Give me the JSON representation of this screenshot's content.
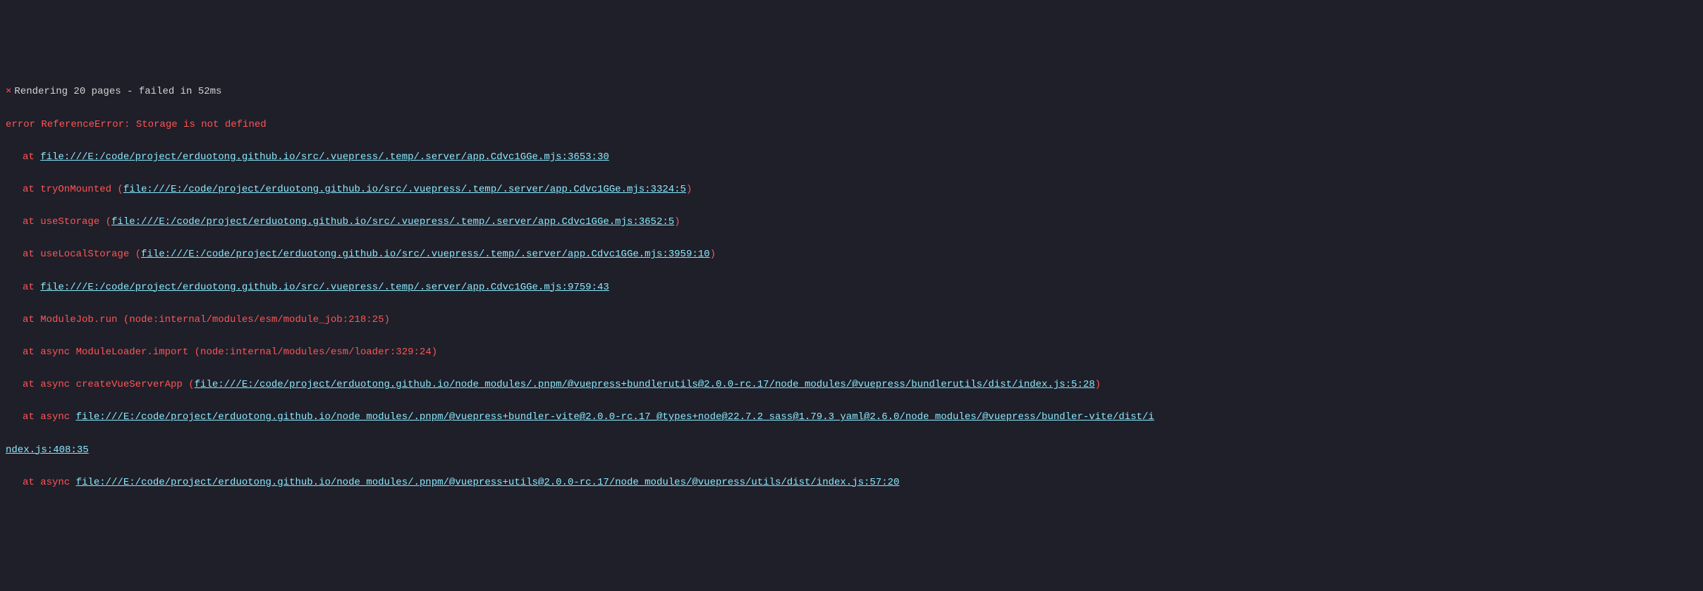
{
  "status": {
    "x_mark": "×",
    "text": "Rendering 20 pages - failed in 52ms"
  },
  "error": {
    "message": "error ReferenceError: Storage is not defined"
  },
  "stack": [
    {
      "prefix": "at ",
      "has_paren": false,
      "link": "file:///E:/code/project/erduotong.github.io/src/.vuepress/.temp/.server/app.Cdvc1GGe.mjs:3653:30",
      "suffix": ""
    },
    {
      "prefix": "at tryOnMounted (",
      "has_paren": true,
      "link": "file:///E:/code/project/erduotong.github.io/src/.vuepress/.temp/.server/app.Cdvc1GGe.mjs:3324:5",
      "suffix": ")"
    },
    {
      "prefix": "at useStorage (",
      "has_paren": true,
      "link": "file:///E:/code/project/erduotong.github.io/src/.vuepress/.temp/.server/app.Cdvc1GGe.mjs:3652:5",
      "suffix": ")"
    },
    {
      "prefix": "at useLocalStorage (",
      "has_paren": true,
      "link": "file:///E:/code/project/erduotong.github.io/src/.vuepress/.temp/.server/app.Cdvc1GGe.mjs:3959:10",
      "suffix": ")"
    },
    {
      "prefix": "at ",
      "has_paren": false,
      "link": "file:///E:/code/project/erduotong.github.io/src/.vuepress/.temp/.server/app.Cdvc1GGe.mjs:9759:43",
      "suffix": ""
    },
    {
      "prefix": "at ModuleJob.run (node:internal/modules/esm/module_job:218:25)",
      "has_paren": false,
      "link": "",
      "suffix": ""
    },
    {
      "prefix": "at async ModuleLoader.import (node:internal/modules/esm/loader:329:24)",
      "has_paren": false,
      "link": "",
      "suffix": ""
    },
    {
      "prefix": "at async createVueServerApp (",
      "has_paren": true,
      "link": "file:///E:/code/project/erduotong.github.io/node_modules/.pnpm/@vuepress+bundlerutils@2.0.0-rc.17/node_modules/@vuepress/bundlerutils/dist/index.js:5:28",
      "suffix": ")"
    },
    {
      "prefix": "at async ",
      "has_paren": false,
      "link": "file:///E:/code/project/erduotong.github.io/node_modules/.pnpm/@vuepress+bundler-vite@2.0.0-rc.17_@types+node@22.7.2_sass@1.79.3_yaml@2.6.0/node_modules/@vuepress/bundler-vite/dist/i",
      "suffix": ""
    }
  ],
  "continuation": "ndex.js:408:35",
  "stack_last": {
    "prefix": "at async ",
    "has_paren": false,
    "link": "file:///E:/code/project/erduotong.github.io/node_modules/.pnpm/@vuepress+utils@2.0.0-rc.17/node_modules/@vuepress/utils/dist/index.js:57:20",
    "suffix": ""
  }
}
